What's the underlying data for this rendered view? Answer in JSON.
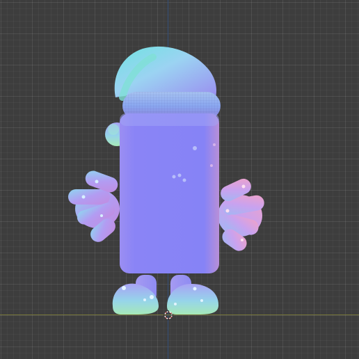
{
  "viewport": {
    "background": "#3d3d3d",
    "grid_color": "#4a4a4a",
    "axis_z_color": "#35507a",
    "axis_y_color": "#76763a"
  },
  "model": {
    "shading": "normal-map",
    "parts": [
      "santa-hat",
      "hat-brim",
      "hat-pompom",
      "body",
      "left-hand",
      "right-hand",
      "left-foot",
      "right-foot"
    ]
  },
  "cursor": {
    "icon": "3d-cursor-icon"
  }
}
